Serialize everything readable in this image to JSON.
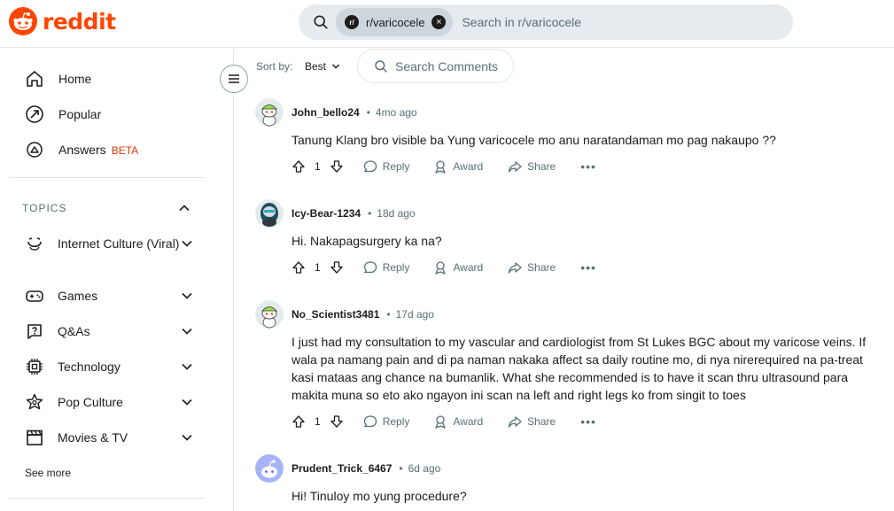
{
  "header": {
    "logo_text": "reddit",
    "brand_color": "#ff4500",
    "search_chip_icon": "r/",
    "search_chip_label": "r/varicocele",
    "search_placeholder": "Search in r/varicocele"
  },
  "sidebar": {
    "nav": [
      {
        "label": "Home",
        "icon": "home-icon"
      },
      {
        "label": "Popular",
        "icon": "popular-icon"
      },
      {
        "label": "Answers",
        "icon": "answers-icon",
        "badge": "BETA"
      }
    ],
    "topics_heading": "TOPICS",
    "topics": [
      {
        "label": "Internet Culture (Viral)",
        "icon": "smile-icon"
      },
      {
        "label": "Games",
        "icon": "gamepad-icon"
      },
      {
        "label": "Q&As",
        "icon": "question-icon"
      },
      {
        "label": "Technology",
        "icon": "chip-icon"
      },
      {
        "label": "Pop Culture",
        "icon": "star-icon"
      },
      {
        "label": "Movies & TV",
        "icon": "clapper-icon"
      }
    ],
    "see_more": "See more"
  },
  "sort": {
    "label": "Sort by:",
    "value": "Best",
    "search_comments": "Search Comments"
  },
  "comments": [
    {
      "username": "John_bello24",
      "age": "4mo ago",
      "body": "Tanung Klang bro visible ba Yung varicocele mo anu naratandaman mo pag nakaupo ??",
      "votes": "1",
      "reply": "Reply",
      "award": "Award",
      "share": "Share"
    },
    {
      "username": "Icy-Bear-1234",
      "age": "18d ago",
      "body": "Hi. Nakapagsurgery ka na?",
      "votes": "1",
      "reply": "Reply",
      "award": "Award",
      "share": "Share"
    },
    {
      "username": "No_Scientist3481",
      "age": "17d ago",
      "body": "I just had my consultation to my vascular and cardiologist from St Lukes BGC about my varicose veins. If wala pa namang pain and di pa naman nakaka affect sa daily routine mo, di nya nirerequired na pa-treat kasi mataas ang chance na bumanlik. What she recommended is to have it scan thru ultrasound para makita muna so eto ako ngayon ini scan na left and right legs ko from singit to toes",
      "votes": "1",
      "reply": "Reply",
      "award": "Award",
      "share": "Share"
    },
    {
      "username": "Prudent_Trick_6467",
      "age": "6d ago",
      "body": "Hi! Tinuloy mo yung procedure?"
    }
  ]
}
